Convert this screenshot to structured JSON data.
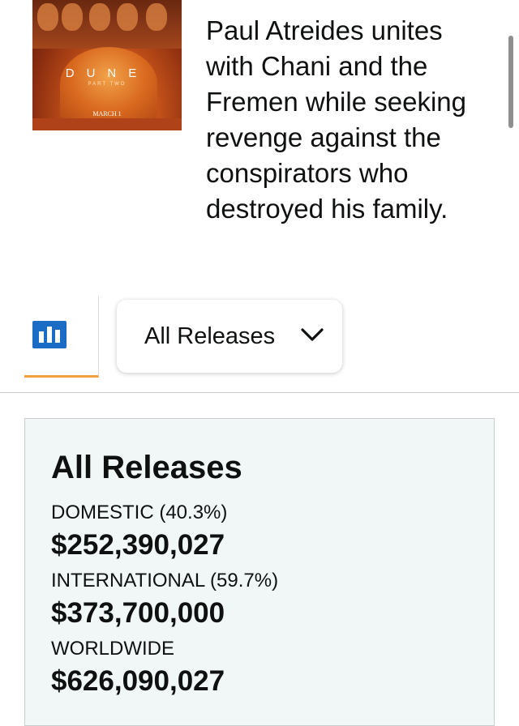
{
  "poster": {
    "title": "DUNE",
    "subtitle": "PART TWO",
    "date": "MARCH 1"
  },
  "synopsis": "Paul Atreides unites with Chani and the Fremen while seeking revenge against the conspirators who destroyed his family.",
  "view_tabs": {
    "chart_icon": "bar-chart-icon"
  },
  "release_select": {
    "selected": "All Releases",
    "icon": "chevron-down-icon"
  },
  "summary": {
    "title": "All Releases",
    "rows": [
      {
        "label": "DOMESTIC (40.3%)",
        "value": "$252,390,027"
      },
      {
        "label": "INTERNATIONAL (59.7%)",
        "value": "$373,700,000"
      },
      {
        "label": "WORLDWIDE",
        "value": "$626,090,027"
      }
    ]
  },
  "colors": {
    "accent_tab": "#f0a13e",
    "chart_icon": "#1a6cc5",
    "card_background": "#f1f7f7"
  }
}
